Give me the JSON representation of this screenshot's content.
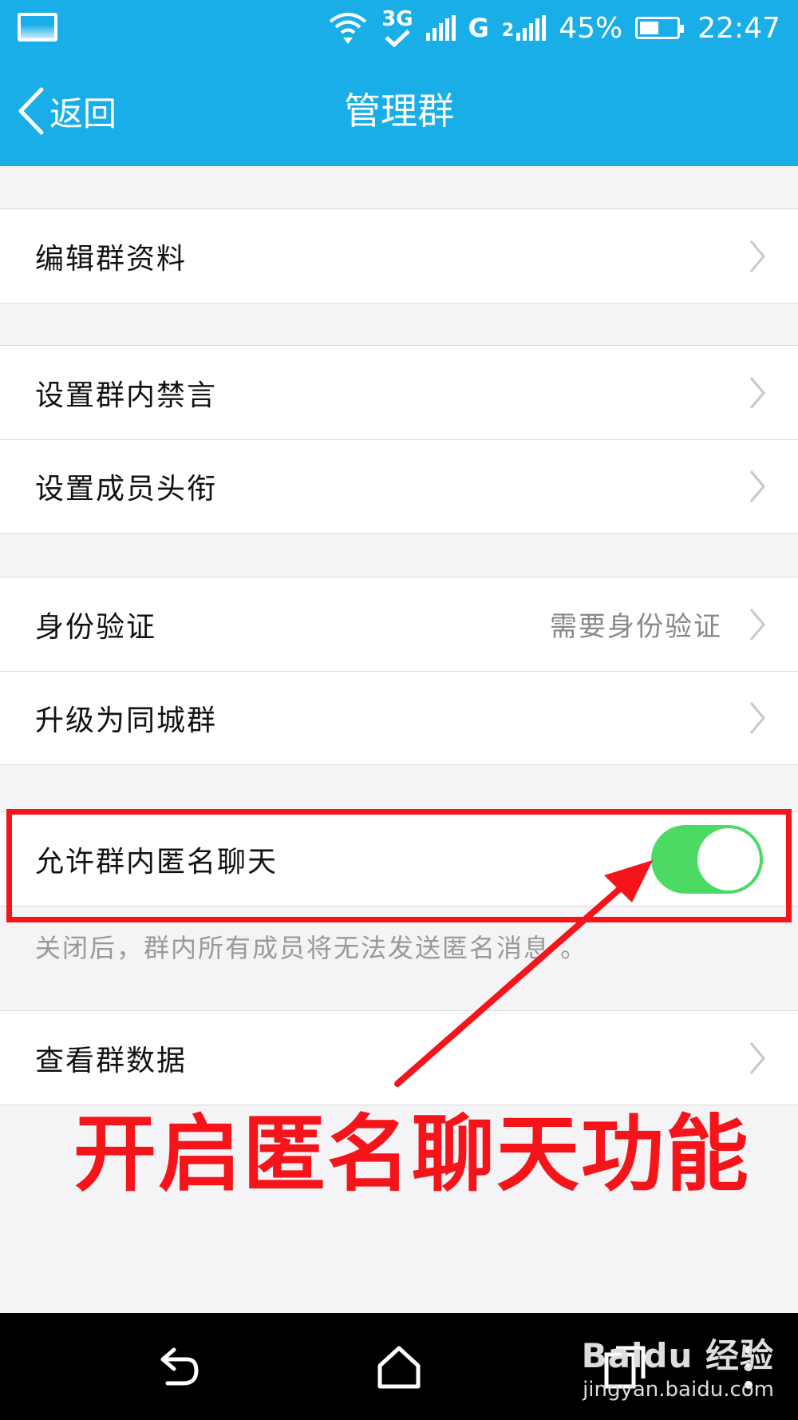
{
  "status_bar": {
    "network_3g": "3G",
    "network_g": "G",
    "network_2": "2",
    "battery": "45%",
    "time": "22:47",
    "icons": [
      "image-icon",
      "wifi-icon",
      "3g-check-icon",
      "signal-icon",
      "signal-icon",
      "battery-icon"
    ]
  },
  "navbar": {
    "back_label": "返回",
    "title": "管理群",
    "color": "#1aaee8"
  },
  "groups": {
    "g1": {
      "rows": [
        {
          "title": "编辑群资料"
        }
      ]
    },
    "g2": {
      "rows": [
        {
          "title": "设置群内禁言"
        },
        {
          "title": "设置成员头衔"
        }
      ]
    },
    "g3": {
      "rows": [
        {
          "title": "身份验证",
          "value": "需要身份验证"
        },
        {
          "title": "升级为同城群"
        }
      ]
    },
    "g4": {
      "rows": [
        {
          "title": "允许群内匿名聊天",
          "toggle_on": true
        }
      ]
    },
    "g5": {
      "rows": [
        {
          "title": "查看群数据"
        }
      ]
    }
  },
  "hint": "关闭后，群内所有成员将无法发送匿名消息 。",
  "annotation": {
    "text": "开启匿名聊天功能",
    "color": "#f4141a"
  },
  "toggle_color": "#4cd964",
  "watermark": {
    "logo": "Baidu 经验",
    "url": "jingyan.baidu.com"
  }
}
